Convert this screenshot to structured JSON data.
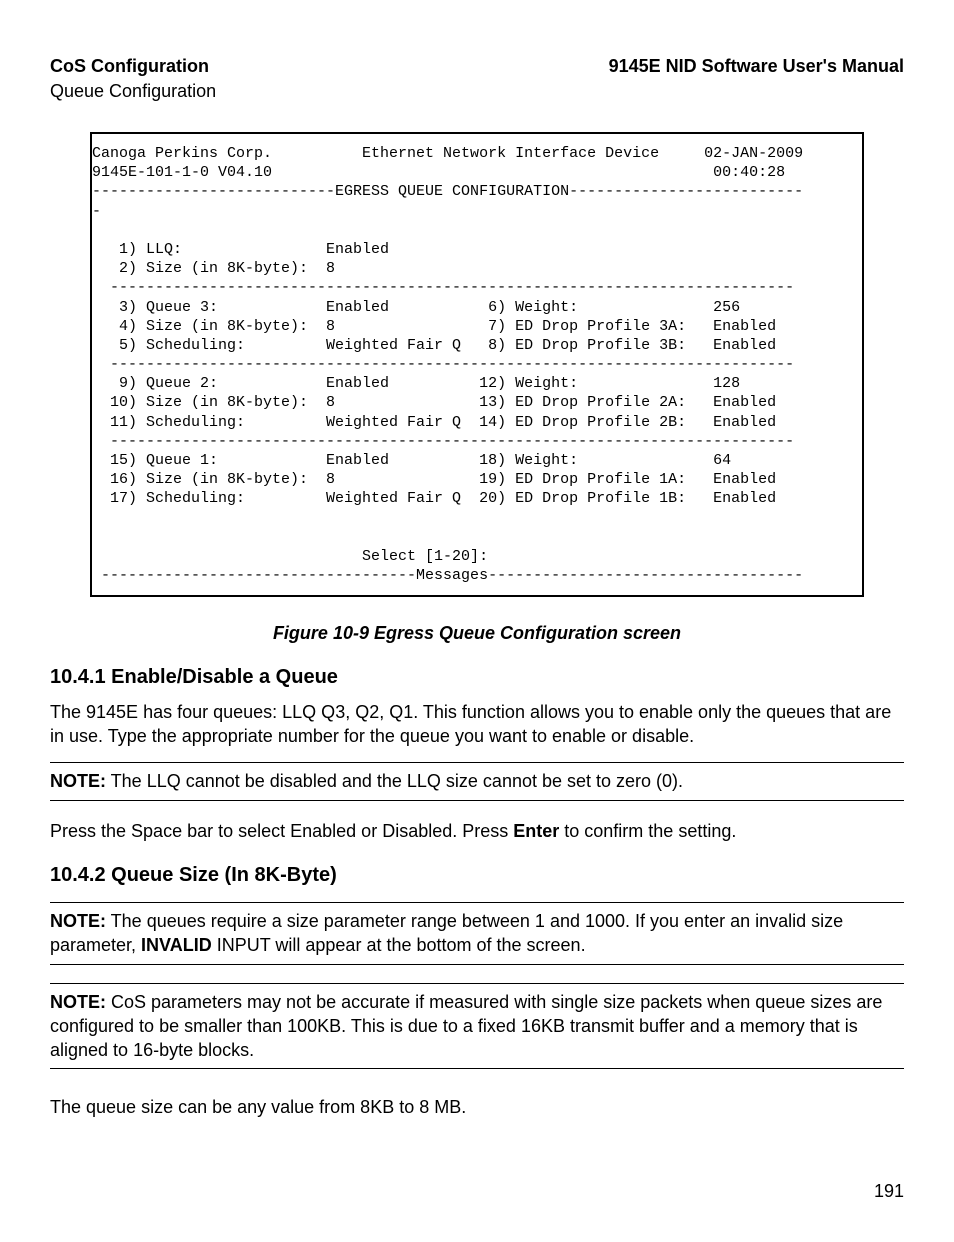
{
  "header": {
    "left": "CoS Configuration",
    "right": "9145E NID Software User's Manual",
    "sub": "Queue Configuration"
  },
  "terminal": {
    "line01": "Canoga Perkins Corp.          Ethernet Network Interface Device     02-JAN-2009",
    "line02": "9145E-101-1-0 V04.10                                                 00:40:28",
    "line03": "---------------------------EGRESS QUEUE CONFIGURATION--------------------------",
    "line03b": "-",
    "gap1": " ",
    "line04": "   1) LLQ:                Enabled",
    "line05": "   2) Size (in 8K-byte):  8",
    "line06": "  ----------------------------------------------------------------------------",
    "line07": "   3) Queue 3:            Enabled           6) Weight:               256",
    "line08": "   4) Size (in 8K-byte):  8                 7) ED Drop Profile 3A:   Enabled",
    "line09": "   5) Scheduling:         Weighted Fair Q   8) ED Drop Profile 3B:   Enabled",
    "line10": "  ----------------------------------------------------------------------------",
    "line11": "   9) Queue 2:            Enabled          12) Weight:               128",
    "line12": "  10) Size (in 8K-byte):  8                13) ED Drop Profile 2A:   Enabled",
    "line13": "  11) Scheduling:         Weighted Fair Q  14) ED Drop Profile 2B:   Enabled",
    "line14": "  ----------------------------------------------------------------------------",
    "line15": "  15) Queue 1:            Enabled          18) Weight:               64",
    "line16": "  16) Size (in 8K-byte):  8                19) ED Drop Profile 1A:   Enabled",
    "line17": "  17) Scheduling:         Weighted Fair Q  20) ED Drop Profile 1B:   Enabled",
    "gap2": " ",
    "gap3": " ",
    "line18": "                              Select [1-20]:",
    "line19": " -----------------------------------Messages-----------------------------------"
  },
  "caption": "Figure 10-9  Egress Queue Configuration screen",
  "section1": {
    "title": "10.4.1  Enable/Disable a Queue",
    "p1": "The 9145E has four queues: LLQ Q3, Q2, Q1. This function allows you to enable only the queues that are in use. Type the appropriate number for the queue you want to enable or disable.",
    "note1_bold": "NOTE:",
    "note1_rest": " The LLQ cannot be disabled and the LLQ size cannot be set to zero (0).",
    "p2_pre": "Press the Space bar to select Enabled or Disabled. Press ",
    "p2_bold": "Enter",
    "p2_post": " to confirm the setting."
  },
  "section2": {
    "title": "10.4.2  Queue Size (In 8K-Byte)",
    "note1_bold": "NOTE:",
    "note1_mid_pre": " The queues require a size parameter range between 1 and 1000. If you enter an invalid size parameter, ",
    "note1_mid_bold": "INVALID",
    "note1_mid_post": " INPUT will appear at the bottom of the screen.",
    "note2_bold": "NOTE:",
    "note2_rest": " CoS parameters may not be accurate if measured with single size packets when queue sizes are configured to be smaller than 100KB. This is due to a fixed 16KB transmit buffer and a memory that is aligned to 16-byte blocks.",
    "p2": "The queue size can be any value from 8KB to 8 MB."
  },
  "footer": {
    "page": "191"
  }
}
